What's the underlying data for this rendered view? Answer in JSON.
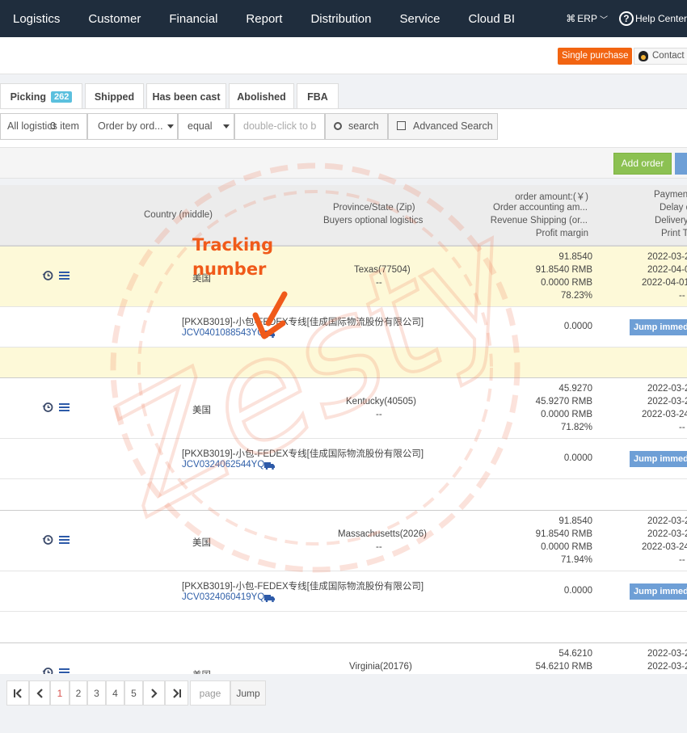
{
  "nav": {
    "items": [
      "Logistics",
      "Customer",
      "Financial",
      "Report",
      "Distribution",
      "Service",
      "Cloud BI"
    ],
    "erp_label": "ERP",
    "help_label": "Help Center"
  },
  "subbar": {
    "single_purchase": "Single purchase",
    "contact": "Contact us"
  },
  "tabs": [
    {
      "label": "Picking",
      "badge": "262"
    },
    {
      "label": "Shipped"
    },
    {
      "label": "Has been cast"
    },
    {
      "label": "Abolished"
    },
    {
      "label": "FBA"
    }
  ],
  "filters": {
    "logistics": "All logistics item",
    "logistics_count": "0",
    "order_by": "Order by ord...",
    "operator": "equal",
    "search_placeholder": "double-click to b",
    "search_btn": "search",
    "advanced_btn": "Advanced Search"
  },
  "actions": {
    "add_order": "Add order"
  },
  "header": {
    "country": "Country (middle)",
    "province": "Province/State (Zip)",
    "buyers_logistics": "Buyers optional logistics",
    "order_amount": "order amount:(￥)",
    "accounting": "Order accounting am...",
    "revenue_shipping": "Revenue Shipping (or...",
    "profit_margin": "Profit margin",
    "payment": "Payment",
    "delay": "Delay d",
    "delivery": "Delivery",
    "print": "Print T"
  },
  "annotation": {
    "line1": "Tracking",
    "line2": "number"
  },
  "orders": [
    {
      "country": "美国",
      "region": "Texas(77504)",
      "region_sub": "--",
      "amounts": [
        "91.8540",
        "91.8540 RMB",
        "0.0000 RMB",
        "78.23%"
      ],
      "dates": [
        "2022-03-2",
        "2022-04-0",
        "2022-04-01",
        "--"
      ],
      "logistics": "[PKXB3019]-小包-FEDEX专线[佳成国际物流股份有限公司]",
      "tracking": "JCV0401088543YQ",
      "ship_amount": "0.0000",
      "jump": "Jump immediately"
    },
    {
      "country": "美国",
      "region": "Kentucky(40505)",
      "region_sub": "--",
      "amounts": [
        "45.9270",
        "45.9270 RMB",
        "0.0000 RMB",
        "71.82%"
      ],
      "dates": [
        "2022-03-2",
        "2022-03-2",
        "2022-03-24",
        "--"
      ],
      "logistics": "[PKXB3019]-小包-FEDEX专线[佳成国际物流股份有限公司]",
      "tracking": "JCV0324062544YQ",
      "ship_amount": "0.0000",
      "jump": "Jump immediately"
    },
    {
      "country": "美国",
      "region": "Massachusetts(2026)",
      "region_sub": "--",
      "amounts": [
        "91.8540",
        "91.8540 RMB",
        "0.0000 RMB",
        "71.94%"
      ],
      "dates": [
        "2022-03-2",
        "2022-03-2",
        "2022-03-24",
        "--"
      ],
      "logistics": "[PKXB3019]-小包-FEDEX专线[佳成国际物流股份有限公司]",
      "tracking": "JCV0324060419YQ",
      "ship_amount": "0.0000",
      "jump": "Jump immediately"
    },
    {
      "country": "美国",
      "region": "Virginia(20176)",
      "amounts": [
        "54.6210",
        "54.6210 RMB"
      ],
      "dates": [
        "2022-03-2",
        "2022-03-2"
      ]
    }
  ],
  "pager": {
    "first": "K",
    "pages": [
      "1",
      "2",
      "3",
      "4",
      "5"
    ],
    "page_placeholder": "page",
    "jump": "Jump"
  },
  "watermark": "Zesty",
  "colors": {
    "nav_bg": "#1f2d3d",
    "highlight_row": "#fdf9d8",
    "accent_orange": "#f05a1a",
    "link_blue": "#2f5fa8",
    "btn_green": "#8cc152",
    "btn_blue": "#6e9fd6"
  }
}
